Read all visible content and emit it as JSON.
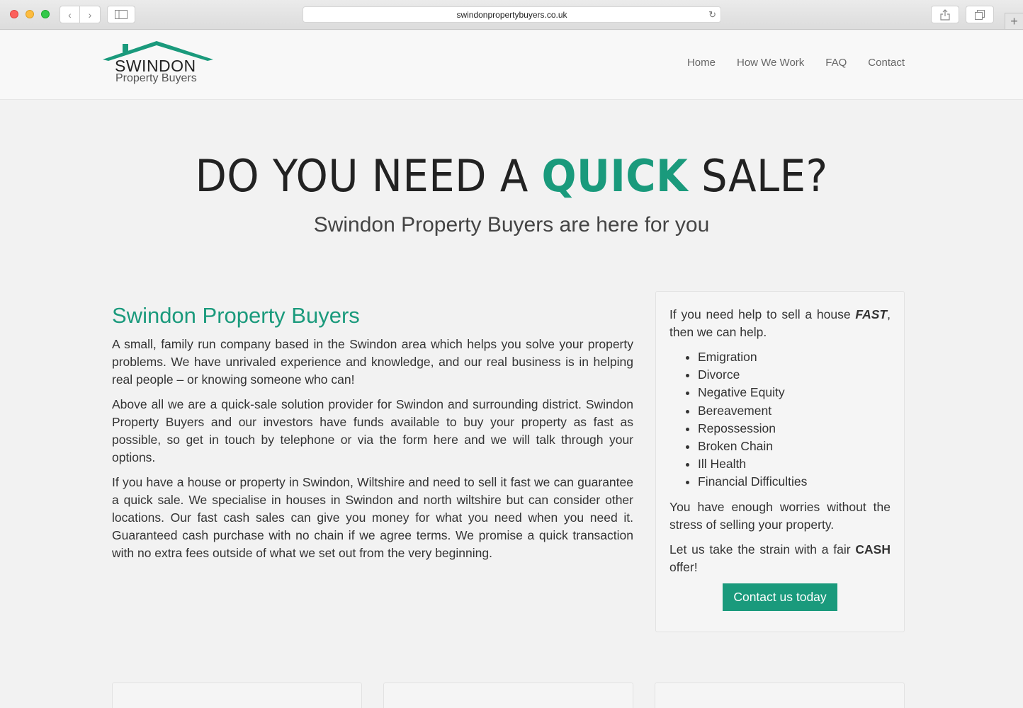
{
  "browser": {
    "url": "swindonpropertybuyers.co.uk",
    "back_icon": "‹",
    "forward_icon": "›",
    "reload_icon": "↻",
    "newtab_icon": "+"
  },
  "header": {
    "logo_main": "SWINDON",
    "logo_sub": "Property Buyers",
    "nav": [
      "Home",
      "How We Work",
      "FAQ",
      "Contact"
    ]
  },
  "hero": {
    "title_before": "DO YOU NEED A ",
    "title_accent": "QUICK",
    "title_after": " SALE?",
    "subtitle": "Swindon Property Buyers are here for you"
  },
  "main": {
    "heading": "Swindon Property Buyers",
    "paragraphs": [
      "A small, family run company based in the Swindon area which helps you solve your property problems. We have unrivaled experience and knowledge, and our real business is in helping real people – or knowing someone who can!",
      "Above all we are a quick-sale solution provider for Swindon and surrounding district. Swindon Property Buyers and our investors have funds available to buy your property as fast as possible, so get in touch by telephone or via the form here and we will talk through your options.",
      "If you have a house or property in Swindon, Wiltshire and need to sell it fast we can guarantee a quick sale. We specialise in houses in Swindon and north wiltshire but can consider other locations. Our fast cash sales can give you money for what you need when you need it. Guaranteed cash purchase with no chain if we agree terms. We promise a quick transaction with no extra fees outside of what we set out from the very beginning."
    ]
  },
  "card": {
    "intro_before": "If you need help to sell a house ",
    "intro_emphasis": "FAST",
    "intro_after": ", then we can help.",
    "reasons": [
      "Emigration",
      "Divorce",
      "Negative Equity",
      "Bereavement",
      "Repossession",
      "Broken Chain",
      "Ill Health",
      "Financial Difficulties"
    ],
    "worries": "You have enough worries without the stress of selling your property.",
    "offer_before": "Let us take the strain with a fair ",
    "offer_bold": "CASH",
    "offer_after": " offer!",
    "cta_label": "Contact us today"
  },
  "colors": {
    "accent": "#1a9a7c",
    "background": "#f2f2f2"
  }
}
